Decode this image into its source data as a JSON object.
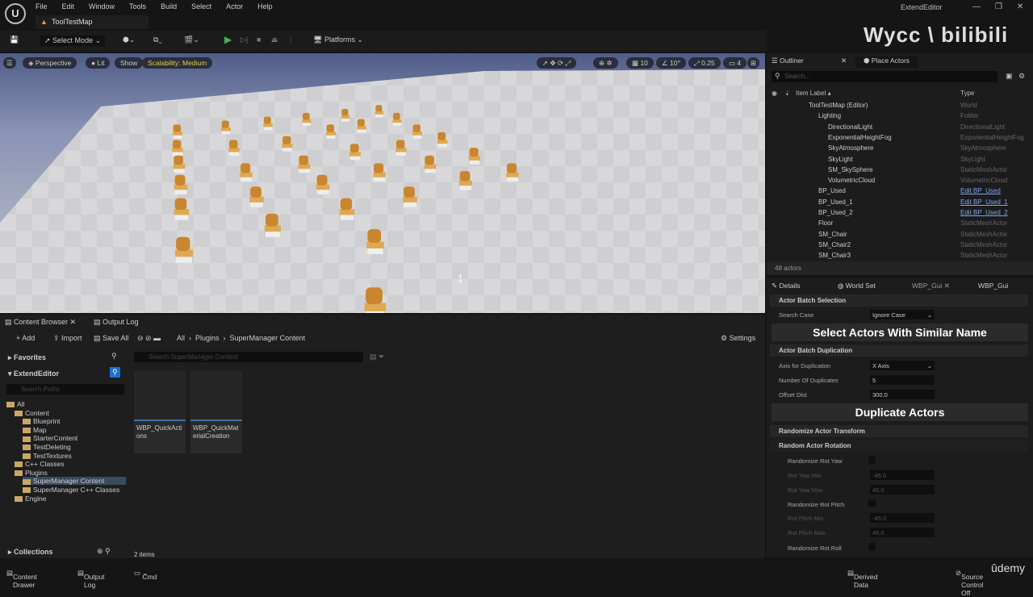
{
  "app": {
    "logo": "U",
    "window_title": "ExtendEditor",
    "map_tab": "ToolTestMap",
    "watermark": "Wycc \\ bilibili",
    "udemy": "ûdemy"
  },
  "menu": [
    "File",
    "Edit",
    "Window",
    "Tools",
    "Build",
    "Select",
    "Actor",
    "Help"
  ],
  "toolbar": {
    "select_mode": "Select Mode",
    "platforms": "Platforms"
  },
  "viewport": {
    "perspective": "Perspective",
    "lit": "Lit",
    "show": "Show",
    "scalability": "Scalability: Medium",
    "grid_snap": "10",
    "rot_snap": "10°",
    "scale_snap": "0.25",
    "camera_speed": "4"
  },
  "outliner": {
    "tab": "Outliner",
    "place_actors": "Place Actors",
    "search_placeholder": "Search...",
    "col_label": "Item Label",
    "col_type": "Type",
    "rows": [
      {
        "label": "ToolTestMap (Editor)",
        "type": "World",
        "indent": 0,
        "link": false
      },
      {
        "label": "Lighting",
        "type": "Folder",
        "indent": 1,
        "link": false
      },
      {
        "label": "DirectionalLight",
        "type": "DirectionalLight",
        "indent": 2,
        "link": false
      },
      {
        "label": "ExponentialHeightFog",
        "type": "ExponentialHeightFog",
        "indent": 2,
        "link": false
      },
      {
        "label": "SkyAtmosphere",
        "type": "SkyAtmosphere",
        "indent": 2,
        "link": false
      },
      {
        "label": "SkyLight",
        "type": "SkyLight",
        "indent": 2,
        "link": false
      },
      {
        "label": "SM_SkySphere",
        "type": "StaticMeshActor",
        "indent": 2,
        "link": false
      },
      {
        "label": "VolumetricCloud",
        "type": "VolumetricCloud",
        "indent": 2,
        "link": false
      },
      {
        "label": "BP_Used",
        "type": "Edit BP_Used",
        "indent": 1,
        "link": true
      },
      {
        "label": "BP_Used_1",
        "type": "Edit BP_Used_1",
        "indent": 1,
        "link": true
      },
      {
        "label": "BP_Used_2",
        "type": "Edit BP_Used_2",
        "indent": 1,
        "link": true
      },
      {
        "label": "Floor",
        "type": "StaticMeshActor",
        "indent": 1,
        "link": false
      },
      {
        "label": "SM_Chair",
        "type": "StaticMeshActor",
        "indent": 1,
        "link": false
      },
      {
        "label": "SM_Chair2",
        "type": "StaticMeshActor",
        "indent": 1,
        "link": false
      },
      {
        "label": "SM_Chair3",
        "type": "StaticMeshActor",
        "indent": 1,
        "link": false
      }
    ],
    "footer": "48 actors"
  },
  "details": {
    "tabs": [
      "Details",
      "World Set",
      "WBP_Gui",
      "WBP_Gui"
    ],
    "sec_selection": "Actor Batch Selection",
    "search_case_label": "Search Case",
    "search_case_value": "Ignore Case",
    "select_button": "Select Actors With Similar Name",
    "sec_duplication": "Actor Batch Duplication",
    "axis_label": "Axis for Duplication",
    "axis_value": "X Axis",
    "num_label": "Number Of Duplicates",
    "num_value": "5",
    "offset_label": "Offset Dist",
    "offset_value": "300.0",
    "duplicate_button": "Duplicate Actors",
    "sec_randomize": "Randomize Actor Transform",
    "sec_rotation": "Random Actor Rotation",
    "rot_yaw": "Randomize Rot Yaw",
    "yaw_min": "Rot Yaw Min",
    "yaw_min_val": "-45.0",
    "yaw_max": "Rot Yaw Max",
    "yaw_max_val": "45.0",
    "rot_pitch": "Randomize Rot Pitch",
    "pitch_min": "Rot Pitch Min",
    "pitch_min_val": "-45.0",
    "pitch_max": "Rot Pitch Max",
    "pitch_max_val": "45.0",
    "rot_roll": "Randomize Rot Roll"
  },
  "content_browser": {
    "tab": "Content Browser",
    "output_tab": "Output Log",
    "add": "+ Add",
    "import": "Import",
    "save_all": "Save All",
    "breadcrumb": [
      "All",
      "Plugins",
      "SuperManager Content"
    ],
    "settings": "Settings",
    "favorites": "Favorites",
    "project": "ExtendEditor",
    "tree_search": "Search Paths",
    "asset_search": "Search SuperManager Content",
    "tree": [
      {
        "label": "All",
        "indent": 0
      },
      {
        "label": "Content",
        "indent": 1
      },
      {
        "label": "Blueprint",
        "indent": 2
      },
      {
        "label": "Map",
        "indent": 2
      },
      {
        "label": "StarterContent",
        "indent": 2
      },
      {
        "label": "TestDeleting",
        "indent": 2
      },
      {
        "label": "TestTextures",
        "indent": 2
      },
      {
        "label": "C++ Classes",
        "indent": 1
      },
      {
        "label": "Plugins",
        "indent": 1
      },
      {
        "label": "SuperManager Content",
        "indent": 2,
        "selected": true
      },
      {
        "label": "SuperManager C++ Classes",
        "indent": 2
      },
      {
        "label": "Engine",
        "indent": 1
      }
    ],
    "assets": [
      {
        "name": "WBP_QuickActions"
      },
      {
        "name": "WBP_QuickMaterialCreation"
      }
    ],
    "collections": "Collections",
    "item_count": "2 items"
  },
  "status": {
    "content_drawer": "Content Drawer",
    "output_log": "Output Log",
    "cmd": "Cmd",
    "derived": "Derived Data",
    "source": "Source Control Off"
  }
}
